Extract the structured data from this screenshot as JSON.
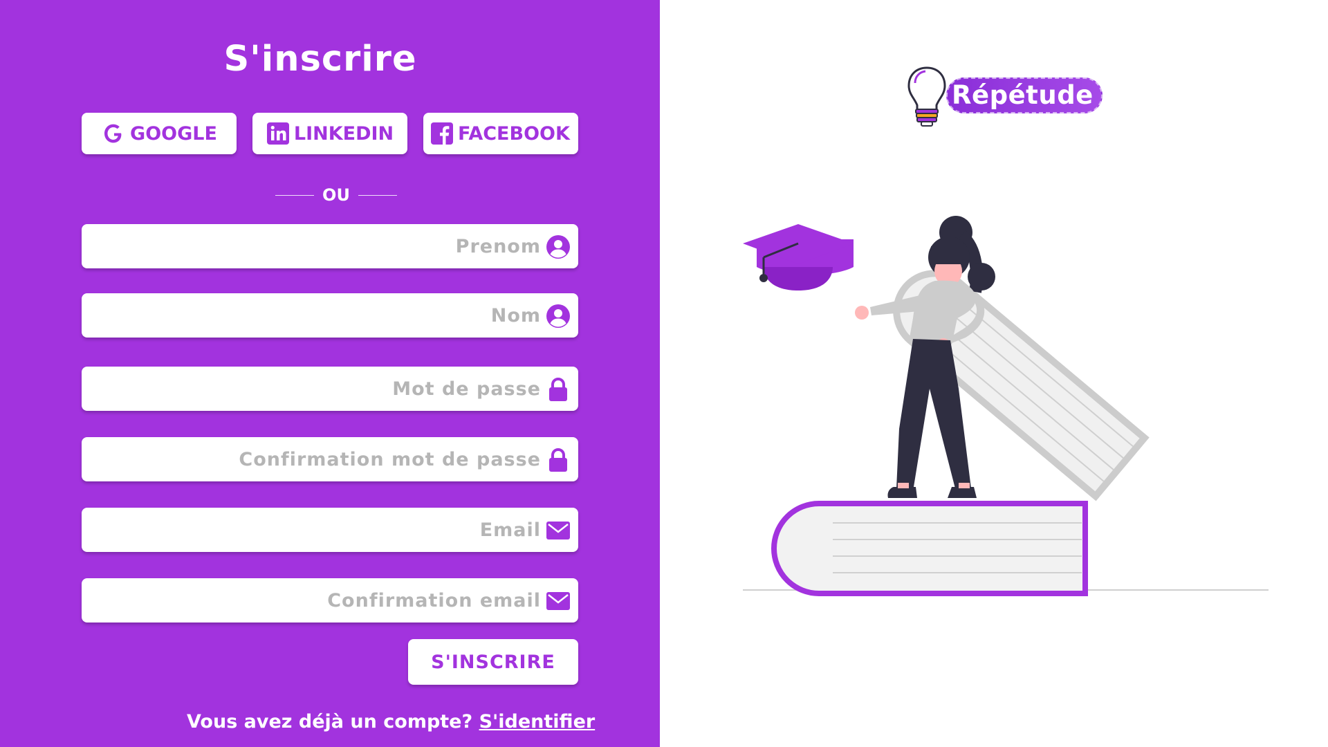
{
  "signup": {
    "title": "S'inscrire",
    "social": [
      {
        "label": "GOOGLE",
        "icon": "google-icon"
      },
      {
        "label": "LINKEDIN",
        "icon": "linkedin-icon"
      },
      {
        "label": "FACEBOOK",
        "icon": "facebook-icon"
      }
    ],
    "separator": "OU",
    "fields": [
      {
        "placeholder": "Prenom",
        "value": "",
        "icon": "user-icon"
      },
      {
        "placeholder": "Nom",
        "value": "",
        "icon": "user-icon"
      },
      {
        "placeholder": "Mot de passe",
        "value": "",
        "icon": "lock-icon"
      },
      {
        "placeholder": "Confirmation mot de passe",
        "value": "",
        "icon": "lock-icon"
      },
      {
        "placeholder": "Email",
        "value": "",
        "icon": "envelope-icon"
      },
      {
        "placeholder": "Confirmation email",
        "value": "",
        "icon": "envelope-icon"
      }
    ],
    "submit_label": "S'INSCRIRE",
    "footer": {
      "text": "Vous avez déjà un compte? ",
      "link": "S'identifier"
    }
  },
  "brand": {
    "name": "Répétude"
  },
  "colors": {
    "primary": "#a233de",
    "placeholder": "#b5b5b5",
    "illustration_dark": "#2f2e41",
    "illustration_light": "#cccccc"
  }
}
